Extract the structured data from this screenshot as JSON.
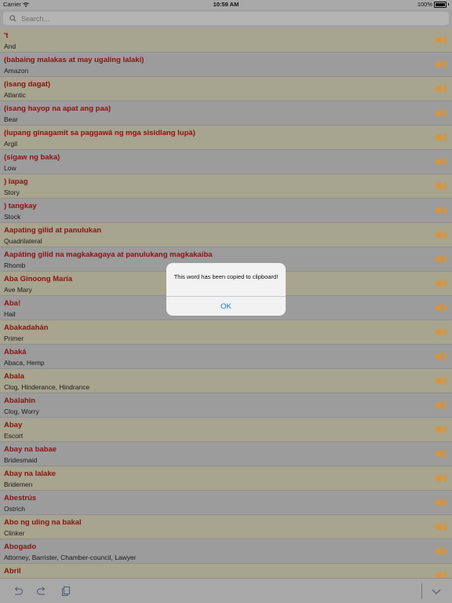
{
  "status": {
    "carrier": "Carrier",
    "time": "10:59 AM",
    "battery": "100%"
  },
  "search": {
    "placeholder": "Search..."
  },
  "entries": [
    {
      "word": "'t",
      "meaning": "And"
    },
    {
      "word": "(babaing malakas at may ugaling lalaki)",
      "meaning": "Amazon"
    },
    {
      "word": "(isang dagat)",
      "meaning": "Atlantic"
    },
    {
      "word": "(isang hayop na apat ang paa)",
      "meaning": "Bear"
    },
    {
      "word": "(lupang ginagamit sa paggawâ ng mga sisidlang lupà)",
      "meaning": "Argil"
    },
    {
      "word": "(sigaw ng baka)",
      "meaning": "Low"
    },
    {
      "word": ") lapag",
      "meaning": "Story"
    },
    {
      "word": ") tangkay",
      "meaning": "Stock"
    },
    {
      "word": "Aapating gilid at panulukan",
      "meaning": "Quadrilateral"
    },
    {
      "word": "Aapáting gilid na magkakagaya at panulukang magkakaiba",
      "meaning": "Rhomb"
    },
    {
      "word": "Aba Ginoong María",
      "meaning": "Ave Mary"
    },
    {
      "word": "Aba!",
      "meaning": "Hail"
    },
    {
      "word": "Abakadahán",
      "meaning": "Primer"
    },
    {
      "word": "Abaká",
      "meaning": "Abaca, Hemp"
    },
    {
      "word": "Abala",
      "meaning": "Clog, Hinderance, Hindrance"
    },
    {
      "word": "Abalahin",
      "meaning": "Clog, Worry"
    },
    {
      "word": "Abay",
      "meaning": "Escort"
    },
    {
      "word": "Abay na babae",
      "meaning": "Bridesmaid"
    },
    {
      "word": "Abay na lalake",
      "meaning": "Bridemen"
    },
    {
      "word": "Abestrús",
      "meaning": "Ostrich"
    },
    {
      "word": "Abo ng uling na bakal",
      "meaning": "Clinker"
    },
    {
      "word": "Abogado",
      "meaning": "Attorney, Barrister, Chamber-council, Lawyer"
    },
    {
      "word": "Abril",
      "meaning": "April"
    }
  ],
  "dialog": {
    "message": "This word has been copied to clipboard!",
    "ok_label": "OK"
  },
  "toolbar": {
    "icons": [
      "undo-icon",
      "redo-icon",
      "copy-icon",
      "chevron-down-icon"
    ]
  },
  "colors": {
    "word": "#8b1111",
    "speaker": "#e0922e",
    "ok": "#1577e6"
  }
}
